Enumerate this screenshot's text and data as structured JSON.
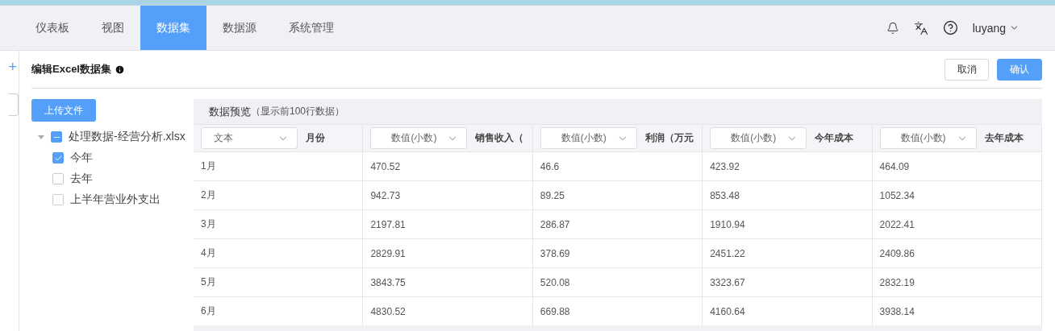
{
  "nav": {
    "tabs": [
      {
        "label": "仪表板",
        "selected": false
      },
      {
        "label": "视图",
        "selected": false
      },
      {
        "label": "数据集",
        "selected": true
      },
      {
        "label": "数据源",
        "selected": false
      },
      {
        "label": "系统管理",
        "selected": false
      }
    ],
    "user": "luyang"
  },
  "sidebar": {
    "add": "+"
  },
  "editor": {
    "title": "编辑Excel数据集",
    "cancel": "取消",
    "confirm": "确认",
    "upload": "上传文件",
    "tree": {
      "label": "处理数据-经营分析.xlsx",
      "expanded": true,
      "indeterminate": true,
      "children": [
        {
          "label": "今年",
          "checked": true
        },
        {
          "label": "去年",
          "checked": false
        },
        {
          "label": "上半年营业外支出",
          "checked": false
        }
      ]
    }
  },
  "preview": {
    "title": "数据预览",
    "note": "（显示前100行数据）",
    "columns": [
      {
        "type": "文本",
        "name": "月份"
      },
      {
        "type": "数值(小数)",
        "name": "销售收入（"
      },
      {
        "type": "数值(小数)",
        "name": "利润（万元"
      },
      {
        "type": "数值(小数)",
        "name": "今年成本"
      },
      {
        "type": "数值(小数)",
        "name": "去年成本"
      }
    ],
    "rows": [
      [
        "1月",
        "470.52",
        "46.6",
        "423.92",
        "464.09"
      ],
      [
        "2月",
        "942.73",
        "89.25",
        "853.48",
        "1052.34"
      ],
      [
        "3月",
        "2197.81",
        "286.87",
        "1910.94",
        "2022.41"
      ],
      [
        "4月",
        "2829.91",
        "378.69",
        "2451.22",
        "2409.86"
      ],
      [
        "5月",
        "3843.75",
        "520.08",
        "3323.67",
        "2832.19"
      ],
      [
        "6月",
        "4830.52",
        "669.88",
        "4160.64",
        "3938.14"
      ]
    ]
  }
}
